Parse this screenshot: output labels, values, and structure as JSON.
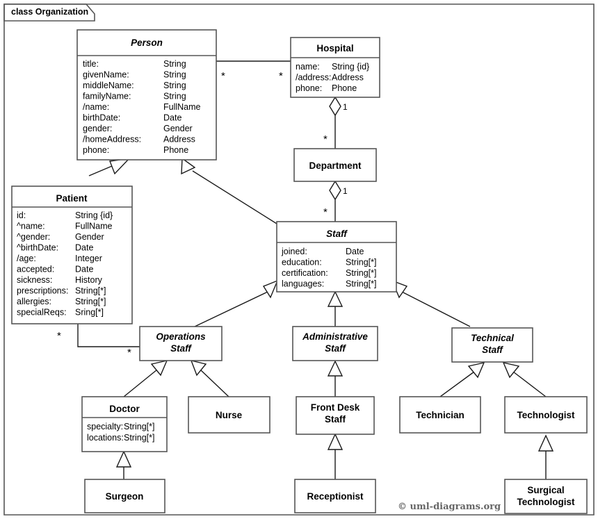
{
  "frame": {
    "label": "class Organization"
  },
  "credit": "© uml-diagrams.org",
  "classes": {
    "person": {
      "name": "Person",
      "abstract": true,
      "attributes": [
        {
          "name": "title:",
          "type": "String"
        },
        {
          "name": "givenName:",
          "type": "String"
        },
        {
          "name": "middleName:",
          "type": "String"
        },
        {
          "name": "familyName:",
          "type": "String"
        },
        {
          "name": "/name:",
          "type": "FullName"
        },
        {
          "name": "birthDate:",
          "type": "Date"
        },
        {
          "name": "gender:",
          "type": "Gender"
        },
        {
          "name": "/homeAddress:",
          "type": "Address"
        },
        {
          "name": "phone:",
          "type": "Phone"
        }
      ]
    },
    "hospital": {
      "name": "Hospital",
      "abstract": false,
      "attributes": [
        {
          "name": "name:",
          "type": "String {id}"
        },
        {
          "name": "/address:",
          "type": "Address"
        },
        {
          "name": "phone:",
          "type": "Phone"
        }
      ]
    },
    "department": {
      "name": "Department",
      "abstract": false,
      "attributes": []
    },
    "patient": {
      "name": "Patient",
      "abstract": false,
      "attributes": [
        {
          "name": "id:",
          "type": "String {id}"
        },
        {
          "name": "^name:",
          "type": "FullName"
        },
        {
          "name": "^gender:",
          "type": "Gender"
        },
        {
          "name": "^birthDate:",
          "type": "Date"
        },
        {
          "name": "/age:",
          "type": "Integer"
        },
        {
          "name": "accepted:",
          "type": "Date"
        },
        {
          "name": "sickness:",
          "type": "History"
        },
        {
          "name": "prescriptions:",
          "type": "String[*]"
        },
        {
          "name": "allergies:",
          "type": "String[*]"
        },
        {
          "name": "specialReqs:",
          "type": "Sring[*]"
        }
      ]
    },
    "staff": {
      "name": "Staff",
      "abstract": true,
      "attributes": [
        {
          "name": "joined:",
          "type": "Date"
        },
        {
          "name": "education:",
          "type": "String[*]"
        },
        {
          "name": "certification:",
          "type": "String[*]"
        },
        {
          "name": "languages:",
          "type": "String[*]"
        }
      ]
    },
    "operations_staff": {
      "name": "Operations Staff",
      "name_line1": "Operations",
      "name_line2": "Staff",
      "abstract": true,
      "attributes": []
    },
    "administrative_staff": {
      "name": "Administrative Staff",
      "name_line1": "Administrative",
      "name_line2": "Staff",
      "abstract": true,
      "attributes": []
    },
    "technical_staff": {
      "name": "Technical Staff",
      "name_line1": "Technical",
      "name_line2": "Staff",
      "abstract": true,
      "attributes": []
    },
    "doctor": {
      "name": "Doctor",
      "abstract": false,
      "attributes": [
        {
          "name": "specialty:",
          "type": "String[*]"
        },
        {
          "name": "locations:",
          "type": "String[*]"
        }
      ]
    },
    "nurse": {
      "name": "Nurse",
      "abstract": false,
      "attributes": []
    },
    "front_desk_staff": {
      "name": "Front Desk Staff",
      "name_line1": "Front Desk",
      "name_line2": "Staff",
      "abstract": false,
      "attributes": []
    },
    "technician": {
      "name": "Technician",
      "abstract": false,
      "attributes": []
    },
    "technologist": {
      "name": "Technologist",
      "abstract": false,
      "attributes": []
    },
    "surgeon": {
      "name": "Surgeon",
      "abstract": false,
      "attributes": []
    },
    "receptionist": {
      "name": "Receptionist",
      "abstract": false,
      "attributes": []
    },
    "surgical_technologist": {
      "name": "Surgical Technologist",
      "name_line1": "Surgical",
      "name_line2": "Technologist",
      "abstract": false,
      "attributes": []
    }
  },
  "multiplicities": {
    "person_hospital_person_end": "*",
    "person_hospital_hospital_end": "*",
    "hospital_department_hospital_end": "1",
    "hospital_department_department_end": "*",
    "department_staff_department_end": "1",
    "department_staff_staff_end": "*",
    "patient_doctor_patient_end": "*",
    "patient_doctor_staff_end": "*"
  },
  "relationships": [
    {
      "from": "Patient",
      "to": "Person",
      "kind": "generalization"
    },
    {
      "from": "Staff",
      "to": "Person",
      "kind": "generalization"
    },
    {
      "from": "Department",
      "to": "Hospital",
      "kind": "composition"
    },
    {
      "from": "Staff",
      "to": "Department",
      "kind": "composition"
    },
    {
      "from": "Person",
      "to": "Hospital",
      "kind": "association"
    },
    {
      "from": "Patient",
      "to": "Operations Staff",
      "kind": "association"
    },
    {
      "from": "Operations Staff",
      "to": "Staff",
      "kind": "generalization"
    },
    {
      "from": "Administrative Staff",
      "to": "Staff",
      "kind": "generalization"
    },
    {
      "from": "Technical Staff",
      "to": "Staff",
      "kind": "generalization"
    },
    {
      "from": "Doctor",
      "to": "Operations Staff",
      "kind": "generalization"
    },
    {
      "from": "Nurse",
      "to": "Operations Staff",
      "kind": "generalization"
    },
    {
      "from": "Front Desk Staff",
      "to": "Administrative Staff",
      "kind": "generalization"
    },
    {
      "from": "Technician",
      "to": "Technical Staff",
      "kind": "generalization"
    },
    {
      "from": "Technologist",
      "to": "Technical Staff",
      "kind": "generalization"
    },
    {
      "from": "Surgeon",
      "to": "Doctor",
      "kind": "generalization"
    },
    {
      "from": "Receptionist",
      "to": "Front Desk Staff",
      "kind": "generalization"
    },
    {
      "from": "Surgical Technologist",
      "to": "Technologist",
      "kind": "generalization"
    }
  ]
}
